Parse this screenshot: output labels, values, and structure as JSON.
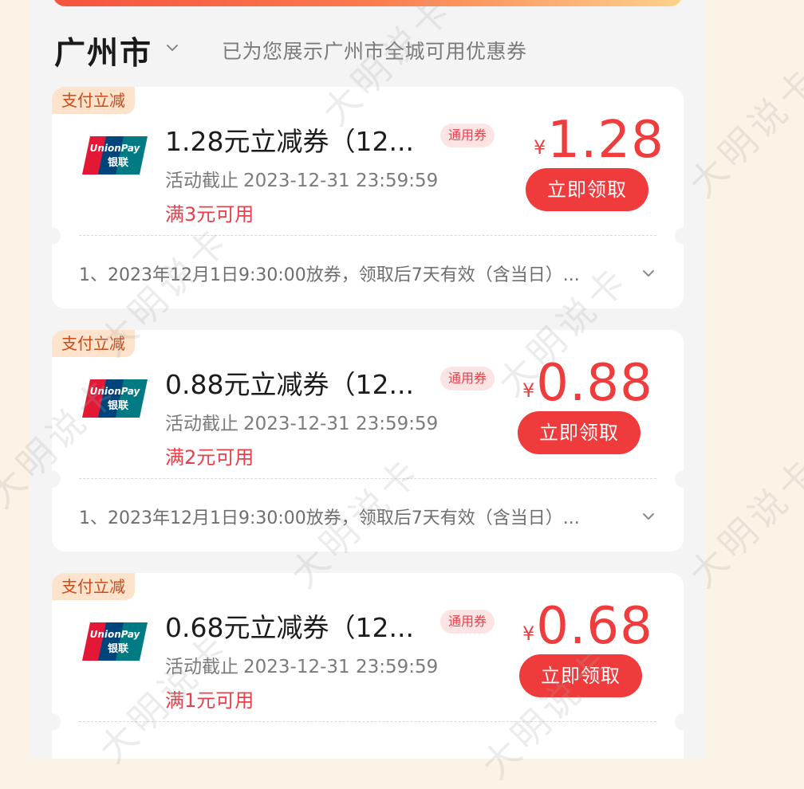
{
  "header": {
    "city": "广州市",
    "hint": "已为您展示广州市全城可用优惠券"
  },
  "coupons": [
    {
      "tag": "支付立减",
      "brand": "UnionPay 银联",
      "title": "1.28元立减券（12...",
      "general_tag": "通用券",
      "deadline_label": "活动截止",
      "deadline": "2023-12-31 23:59:59",
      "condition": "满3元可用",
      "currency": "¥",
      "amount": "1.28",
      "button": "立即领取",
      "rule": "1、2023年12月1日9:30:00放券，领取后7天有效（含当日）..."
    },
    {
      "tag": "支付立减",
      "brand": "UnionPay 银联",
      "title": "0.88元立减券（12...",
      "general_tag": "通用券",
      "deadline_label": "活动截止",
      "deadline": "2023-12-31 23:59:59",
      "condition": "满2元可用",
      "currency": "¥",
      "amount": "0.88",
      "button": "立即领取",
      "rule": "1、2023年12月1日9:30:00放券，领取后7天有效（含当日）..."
    },
    {
      "tag": "支付立减",
      "brand": "UnionPay 银联",
      "title": "0.68元立减券（12...",
      "general_tag": "通用券",
      "deadline_label": "活动截止",
      "deadline": "2023-12-31 23:59:59",
      "condition": "满1元可用",
      "currency": "¥",
      "amount": "0.68",
      "button": "立即领取",
      "rule": ""
    }
  ],
  "watermark": "大明说卡",
  "colors": {
    "accent": "#ef3b3b",
    "price": "#f03c3c",
    "tag_bg": "#fde2cc",
    "tag_text": "#cc4a1c",
    "page_bg": "#fbf3e6"
  },
  "icons": {
    "city_dropdown": "chevron-down-icon",
    "rule_expand": "chevron-down-icon",
    "logo": "unionpay-logo"
  }
}
